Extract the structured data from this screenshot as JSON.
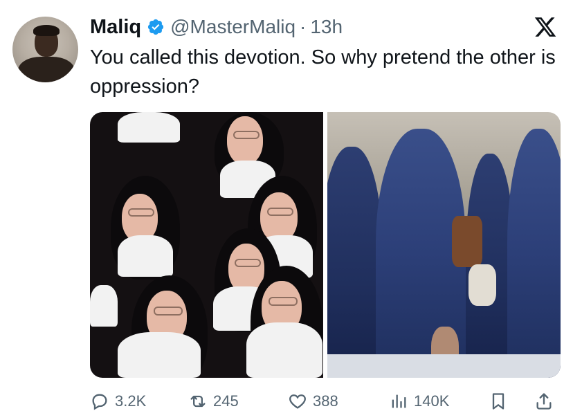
{
  "tweet": {
    "display_name": "Maliq",
    "handle": "@MasterMaliq",
    "separator": "·",
    "time": "13h",
    "text": "You called this devotion. So why pretend the other is oppression?",
    "brand_icon": "x-logo-icon",
    "verified_color": "#1d9bf0"
  },
  "media": {
    "images": [
      {
        "subject": "nuns-photo"
      },
      {
        "subject": "burqas-photo"
      }
    ]
  },
  "actions": {
    "replies": "3.2K",
    "reposts": "245",
    "likes": "388",
    "views": "140K",
    "icons": [
      "reply-icon",
      "repost-icon",
      "like-icon",
      "views-icon",
      "bookmark-icon",
      "share-icon"
    ]
  }
}
